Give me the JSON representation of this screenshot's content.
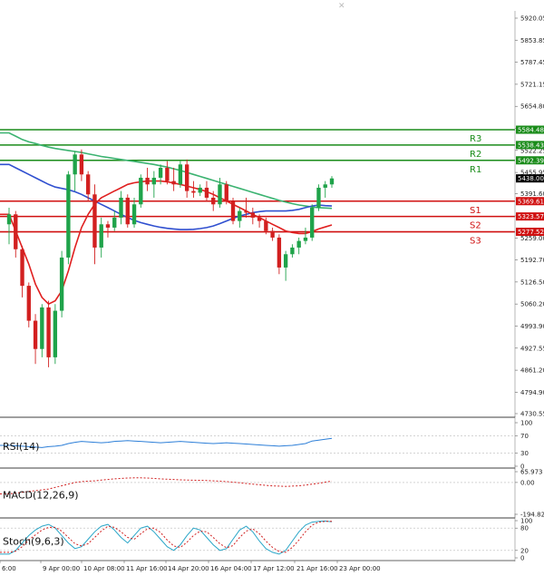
{
  "chart_data": {
    "type": "candlestick",
    "main_price_axis": [
      "5920.05",
      "5853.85",
      "5787.45",
      "5721.15",
      "5654.80",
      "5588.60",
      "5522.25",
      "5455.95",
      "5391.60",
      "5325.35",
      "5259.00",
      "5192.70",
      "5126.50",
      "5060.20",
      "4993.90",
      "4927.55",
      "4861.20",
      "4794.90",
      "4730.55"
    ],
    "main_ylim": [
      4730.55,
      5920.05
    ],
    "x_tick_labels": [
      "6:00",
      "9 Apr 00:00",
      "10 Apr 08:00",
      "11 Apr 16:00",
      "14 Apr 20:00",
      "16 Apr 04:00",
      "17 Apr 12:00",
      "21 Apr 16:00",
      "23 Apr 00:00"
    ],
    "levels": [
      {
        "name": "R3",
        "value": 5584.48,
        "value_label": "5584.48",
        "color": "#1a8c1a"
      },
      {
        "name": "R2",
        "value": 5538.43,
        "value_label": "5538.43",
        "color": "#1a8c1a"
      },
      {
        "name": "R1",
        "value": 5492.39,
        "value_label": "5492.39",
        "color": "#1a8c1a"
      },
      {
        "name": "S1",
        "value": 5369.61,
        "value_label": "5369.61",
        "color": "#d01010"
      },
      {
        "name": "S2",
        "value": 5323.57,
        "value_label": "5323.57",
        "color": "#d01010"
      },
      {
        "name": "S3",
        "value": 5277.52,
        "value_label": "5277.52",
        "color": "#d01010"
      }
    ],
    "current_price": {
      "value": 5438.0,
      "label": "5438.00"
    },
    "candles": [
      [
        5300,
        5350,
        5240,
        5330
      ],
      [
        5330,
        5340,
        5200,
        5225
      ],
      [
        5225,
        5235,
        5080,
        5115
      ],
      [
        5115,
        5125,
        4990,
        5010
      ],
      [
        5010,
        5030,
        4880,
        4925
      ],
      [
        4925,
        5060,
        4900,
        5050
      ],
      [
        5050,
        5070,
        4870,
        4900
      ],
      [
        4900,
        5060,
        4880,
        5040
      ],
      [
        5040,
        5220,
        5020,
        5200
      ],
      [
        5200,
        5460,
        5180,
        5450
      ],
      [
        5450,
        5520,
        5400,
        5510
      ],
      [
        5510,
        5525,
        5430,
        5450
      ],
      [
        5450,
        5460,
        5370,
        5390
      ],
      [
        5390,
        5420,
        5180,
        5230
      ],
      [
        5230,
        5320,
        5200,
        5300
      ],
      [
        5300,
        5310,
        5260,
        5290
      ],
      [
        5290,
        5340,
        5280,
        5320
      ],
      [
        5320,
        5400,
        5300,
        5380
      ],
      [
        5380,
        5390,
        5290,
        5300
      ],
      [
        5300,
        5380,
        5290,
        5360
      ],
      [
        5360,
        5450,
        5350,
        5440
      ],
      [
        5440,
        5470,
        5400,
        5420
      ],
      [
        5420,
        5460,
        5380,
        5440
      ],
      [
        5440,
        5480,
        5420,
        5470
      ],
      [
        5470,
        5490,
        5420,
        5430
      ],
      [
        5430,
        5470,
        5400,
        5420
      ],
      [
        5420,
        5490,
        5410,
        5480
      ],
      [
        5480,
        5495,
        5380,
        5400
      ],
      [
        5400,
        5430,
        5380,
        5395
      ],
      [
        5395,
        5420,
        5385,
        5410
      ],
      [
        5410,
        5430,
        5370,
        5380
      ],
      [
        5380,
        5400,
        5340,
        5360
      ],
      [
        5360,
        5440,
        5350,
        5420
      ],
      [
        5420,
        5430,
        5360,
        5370
      ],
      [
        5370,
        5380,
        5300,
        5310
      ],
      [
        5310,
        5350,
        5290,
        5340
      ],
      [
        5340,
        5380,
        5320,
        5335
      ],
      [
        5335,
        5350,
        5300,
        5320
      ],
      [
        5320,
        5330,
        5290,
        5310
      ],
      [
        5310,
        5320,
        5270,
        5280
      ],
      [
        5280,
        5290,
        5250,
        5260
      ],
      [
        5260,
        5270,
        5150,
        5170
      ],
      [
        5170,
        5220,
        5130,
        5210
      ],
      [
        5210,
        5240,
        5200,
        5230
      ],
      [
        5230,
        5260,
        5210,
        5250
      ],
      [
        5250,
        5290,
        5240,
        5260
      ],
      [
        5260,
        5360,
        5250,
        5350
      ],
      [
        5350,
        5420,
        5340,
        5410
      ],
      [
        5410,
        5430,
        5380,
        5420
      ],
      [
        5420,
        5445,
        5410,
        5438
      ]
    ],
    "series": [
      {
        "name": "",
        "color": "#3cb371",
        "values": [
          5575,
          5565,
          5555,
          5548,
          5543,
          5537,
          5532,
          5528,
          5525,
          5522,
          5519,
          5516,
          5512,
          5508,
          5504,
          5501,
          5498,
          5495,
          5492,
          5489,
          5486,
          5483,
          5480,
          5476,
          5472,
          5467,
          5462,
          5456,
          5450,
          5444,
          5438,
          5432,
          5426,
          5420,
          5414,
          5408,
          5402,
          5396,
          5390,
          5384,
          5378,
          5372,
          5367,
          5362,
          5358,
          5355,
          5352,
          5350,
          5349,
          5348
        ]
      },
      {
        "name": "",
        "color": "#3050d0",
        "values": [
          5480,
          5470,
          5460,
          5450,
          5440,
          5430,
          5420,
          5412,
          5408,
          5404,
          5398,
          5390,
          5380,
          5370,
          5360,
          5350,
          5340,
          5330,
          5320,
          5312,
          5305,
          5300,
          5295,
          5291,
          5288,
          5286,
          5284,
          5284,
          5285,
          5287,
          5290,
          5295,
          5302,
          5310,
          5318,
          5325,
          5330,
          5335,
          5338,
          5340,
          5340,
          5340,
          5340,
          5342,
          5345,
          5350,
          5355,
          5358,
          5356,
          5355
        ]
      },
      {
        "name": "",
        "color": "#e02020",
        "values": [
          5330,
          5280,
          5230,
          5180,
          5120,
          5080,
          5060,
          5070,
          5100,
          5160,
          5230,
          5290,
          5330,
          5360,
          5380,
          5390,
          5400,
          5410,
          5420,
          5425,
          5428,
          5430,
          5430,
          5430,
          5428,
          5424,
          5420,
          5415,
          5410,
          5405,
          5398,
          5390,
          5380,
          5370,
          5360,
          5350,
          5340,
          5330,
          5320,
          5310,
          5300,
          5290,
          5280,
          5275,
          5272,
          5272,
          5278,
          5286,
          5292,
          5298
        ]
      }
    ],
    "rsi": {
      "label": "RSI(14)",
      "axis": [
        "100",
        "70",
        "30",
        "0"
      ],
      "values": [
        48,
        47,
        46,
        45,
        44,
        43,
        45,
        46,
        48,
        52,
        55,
        57,
        56,
        55,
        54,
        55,
        57,
        58,
        59,
        58,
        57,
        56,
        55,
        54,
        55,
        56,
        57,
        56,
        55,
        54,
        53,
        52,
        53,
        54,
        53,
        52,
        51,
        50,
        49,
        48,
        47,
        46,
        47,
        48,
        50,
        52,
        58,
        60,
        62,
        64
      ]
    },
    "macd": {
      "label": "MACD(12,26,9)",
      "axis": [
        "65.973",
        "0.00",
        "-194.822"
      ],
      "values": [
        -70,
        -65,
        -60,
        -55,
        -50,
        -45,
        -40,
        -30,
        -20,
        -10,
        0,
        5,
        8,
        10,
        15,
        18,
        22,
        25,
        27,
        28,
        28,
        27,
        25,
        22,
        20,
        18,
        16,
        15,
        14,
        13,
        12,
        10,
        8,
        5,
        2,
        -2,
        -6,
        -10,
        -14,
        -18,
        -21,
        -22,
        -24,
        -22,
        -20,
        -16,
        -10,
        -5,
        2,
        8
      ]
    },
    "stoch": {
      "label": "Stoch(9,6,3)",
      "axis": [
        "100",
        "80",
        "20",
        "0"
      ],
      "k": [
        10,
        20,
        40,
        60,
        75,
        85,
        90,
        80,
        60,
        40,
        25,
        30,
        50,
        70,
        85,
        90,
        75,
        55,
        40,
        60,
        80,
        85,
        70,
        50,
        30,
        20,
        35,
        60,
        80,
        75,
        55,
        35,
        20,
        25,
        50,
        75,
        85,
        70,
        45,
        25,
        15,
        10,
        20,
        45,
        70,
        88,
        96,
        98,
        99,
        97
      ],
      "d": [
        15,
        18,
        30,
        48,
        62,
        75,
        82,
        82,
        72,
        55,
        38,
        32,
        38,
        55,
        72,
        85,
        82,
        70,
        55,
        50,
        65,
        78,
        80,
        68,
        48,
        32,
        28,
        42,
        60,
        72,
        70,
        55,
        38,
        27,
        33,
        55,
        72,
        78,
        65,
        45,
        28,
        17,
        15,
        28,
        48,
        70,
        88,
        96,
        98,
        98
      ]
    }
  }
}
